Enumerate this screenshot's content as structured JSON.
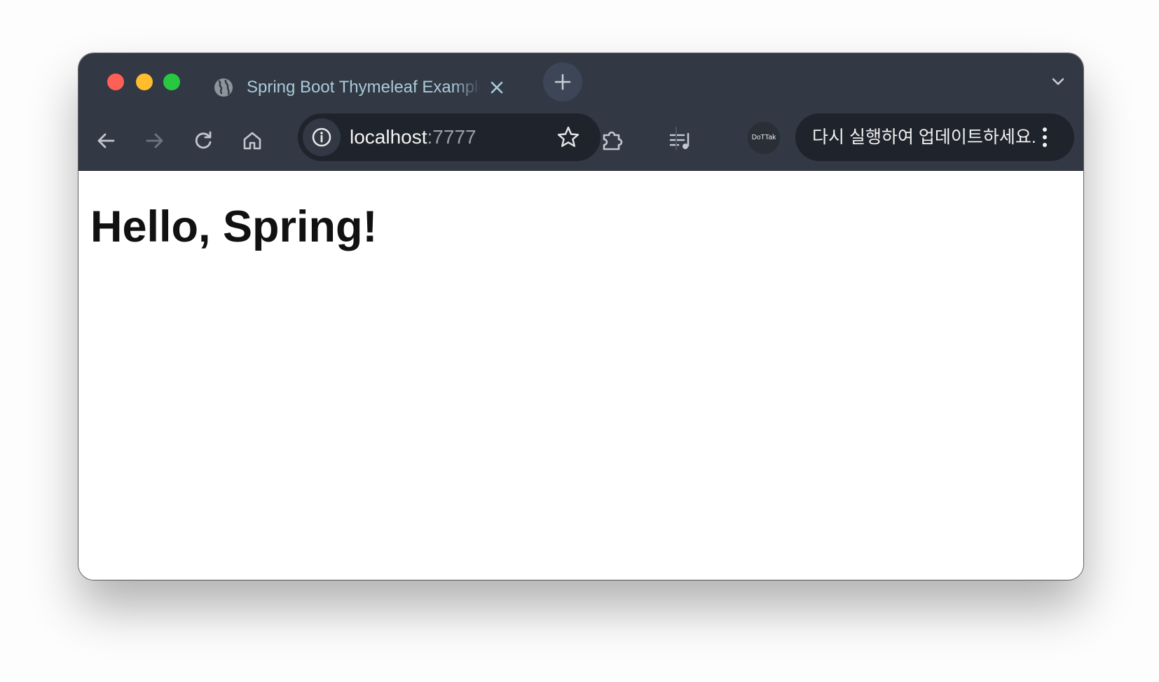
{
  "window": {
    "controls": [
      "close",
      "minimize",
      "maximize"
    ]
  },
  "tab": {
    "title": "Spring Boot Thymeleaf Example",
    "favicon": "globe-icon"
  },
  "address_bar": {
    "host": "localhost",
    "port": ":7777"
  },
  "profile": {
    "label": "DoTTak"
  },
  "update_chip": {
    "label": "다시 실행하여 업데이트하세요."
  },
  "page": {
    "heading": "Hello, Spring!"
  },
  "colors": {
    "chrome_bg": "#323844",
    "omnibox_bg": "#1f232b",
    "tab_text": "#a9cbd8",
    "close": "#fe5f57",
    "minimize": "#febc2e",
    "maximize": "#28c840"
  }
}
